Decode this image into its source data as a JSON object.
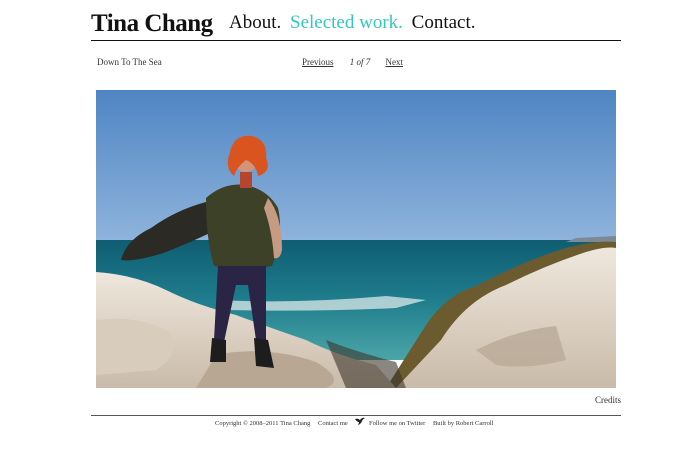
{
  "site": {
    "brand": "Tina Chang",
    "nav": [
      {
        "label": "About.",
        "active": false
      },
      {
        "label": "Selected work.",
        "active": true
      },
      {
        "label": "Contact.",
        "active": false
      }
    ]
  },
  "gallery": {
    "title": "Down To The Sea",
    "previous_label": "Previous",
    "count": "1 of 7",
    "next_label": "Next",
    "credits_label": "Credits"
  },
  "footer": {
    "copyright": "Copyright © 2008–2011 Tina Chang",
    "contact_label": "Contact me",
    "twitter_icon": "bird-icon",
    "twitter_label": "Follow me on Twitter",
    "built_by": "Built by Robert Carroll"
  },
  "colors": {
    "accent": "#35c6c0",
    "sky": "#5a8cc6",
    "sea": "#1d6e80"
  }
}
